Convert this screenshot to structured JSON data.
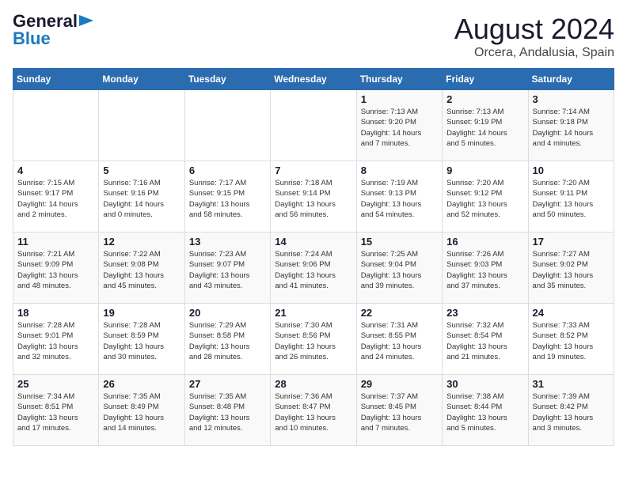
{
  "header": {
    "logo_general": "General",
    "logo_blue": "Blue",
    "month_title": "August 2024",
    "subtitle": "Orcera, Andalusia, Spain"
  },
  "days_of_week": [
    "Sunday",
    "Monday",
    "Tuesday",
    "Wednesday",
    "Thursday",
    "Friday",
    "Saturday"
  ],
  "weeks": [
    [
      {
        "day": "",
        "info": ""
      },
      {
        "day": "",
        "info": ""
      },
      {
        "day": "",
        "info": ""
      },
      {
        "day": "",
        "info": ""
      },
      {
        "day": "1",
        "info": "Sunrise: 7:13 AM\nSunset: 9:20 PM\nDaylight: 14 hours\nand 7 minutes."
      },
      {
        "day": "2",
        "info": "Sunrise: 7:13 AM\nSunset: 9:19 PM\nDaylight: 14 hours\nand 5 minutes."
      },
      {
        "day": "3",
        "info": "Sunrise: 7:14 AM\nSunset: 9:18 PM\nDaylight: 14 hours\nand 4 minutes."
      }
    ],
    [
      {
        "day": "4",
        "info": "Sunrise: 7:15 AM\nSunset: 9:17 PM\nDaylight: 14 hours\nand 2 minutes."
      },
      {
        "day": "5",
        "info": "Sunrise: 7:16 AM\nSunset: 9:16 PM\nDaylight: 14 hours\nand 0 minutes."
      },
      {
        "day": "6",
        "info": "Sunrise: 7:17 AM\nSunset: 9:15 PM\nDaylight: 13 hours\nand 58 minutes."
      },
      {
        "day": "7",
        "info": "Sunrise: 7:18 AM\nSunset: 9:14 PM\nDaylight: 13 hours\nand 56 minutes."
      },
      {
        "day": "8",
        "info": "Sunrise: 7:19 AM\nSunset: 9:13 PM\nDaylight: 13 hours\nand 54 minutes."
      },
      {
        "day": "9",
        "info": "Sunrise: 7:20 AM\nSunset: 9:12 PM\nDaylight: 13 hours\nand 52 minutes."
      },
      {
        "day": "10",
        "info": "Sunrise: 7:20 AM\nSunset: 9:11 PM\nDaylight: 13 hours\nand 50 minutes."
      }
    ],
    [
      {
        "day": "11",
        "info": "Sunrise: 7:21 AM\nSunset: 9:09 PM\nDaylight: 13 hours\nand 48 minutes."
      },
      {
        "day": "12",
        "info": "Sunrise: 7:22 AM\nSunset: 9:08 PM\nDaylight: 13 hours\nand 45 minutes."
      },
      {
        "day": "13",
        "info": "Sunrise: 7:23 AM\nSunset: 9:07 PM\nDaylight: 13 hours\nand 43 minutes."
      },
      {
        "day": "14",
        "info": "Sunrise: 7:24 AM\nSunset: 9:06 PM\nDaylight: 13 hours\nand 41 minutes."
      },
      {
        "day": "15",
        "info": "Sunrise: 7:25 AM\nSunset: 9:04 PM\nDaylight: 13 hours\nand 39 minutes."
      },
      {
        "day": "16",
        "info": "Sunrise: 7:26 AM\nSunset: 9:03 PM\nDaylight: 13 hours\nand 37 minutes."
      },
      {
        "day": "17",
        "info": "Sunrise: 7:27 AM\nSunset: 9:02 PM\nDaylight: 13 hours\nand 35 minutes."
      }
    ],
    [
      {
        "day": "18",
        "info": "Sunrise: 7:28 AM\nSunset: 9:01 PM\nDaylight: 13 hours\nand 32 minutes."
      },
      {
        "day": "19",
        "info": "Sunrise: 7:28 AM\nSunset: 8:59 PM\nDaylight: 13 hours\nand 30 minutes."
      },
      {
        "day": "20",
        "info": "Sunrise: 7:29 AM\nSunset: 8:58 PM\nDaylight: 13 hours\nand 28 minutes."
      },
      {
        "day": "21",
        "info": "Sunrise: 7:30 AM\nSunset: 8:56 PM\nDaylight: 13 hours\nand 26 minutes."
      },
      {
        "day": "22",
        "info": "Sunrise: 7:31 AM\nSunset: 8:55 PM\nDaylight: 13 hours\nand 24 minutes."
      },
      {
        "day": "23",
        "info": "Sunrise: 7:32 AM\nSunset: 8:54 PM\nDaylight: 13 hours\nand 21 minutes."
      },
      {
        "day": "24",
        "info": "Sunrise: 7:33 AM\nSunset: 8:52 PM\nDaylight: 13 hours\nand 19 minutes."
      }
    ],
    [
      {
        "day": "25",
        "info": "Sunrise: 7:34 AM\nSunset: 8:51 PM\nDaylight: 13 hours\nand 17 minutes."
      },
      {
        "day": "26",
        "info": "Sunrise: 7:35 AM\nSunset: 8:49 PM\nDaylight: 13 hours\nand 14 minutes."
      },
      {
        "day": "27",
        "info": "Sunrise: 7:35 AM\nSunset: 8:48 PM\nDaylight: 13 hours\nand 12 minutes."
      },
      {
        "day": "28",
        "info": "Sunrise: 7:36 AM\nSunset: 8:47 PM\nDaylight: 13 hours\nand 10 minutes."
      },
      {
        "day": "29",
        "info": "Sunrise: 7:37 AM\nSunset: 8:45 PM\nDaylight: 13 hours\nand 7 minutes."
      },
      {
        "day": "30",
        "info": "Sunrise: 7:38 AM\nSunset: 8:44 PM\nDaylight: 13 hours\nand 5 minutes."
      },
      {
        "day": "31",
        "info": "Sunrise: 7:39 AM\nSunset: 8:42 PM\nDaylight: 13 hours\nand 3 minutes."
      }
    ]
  ]
}
